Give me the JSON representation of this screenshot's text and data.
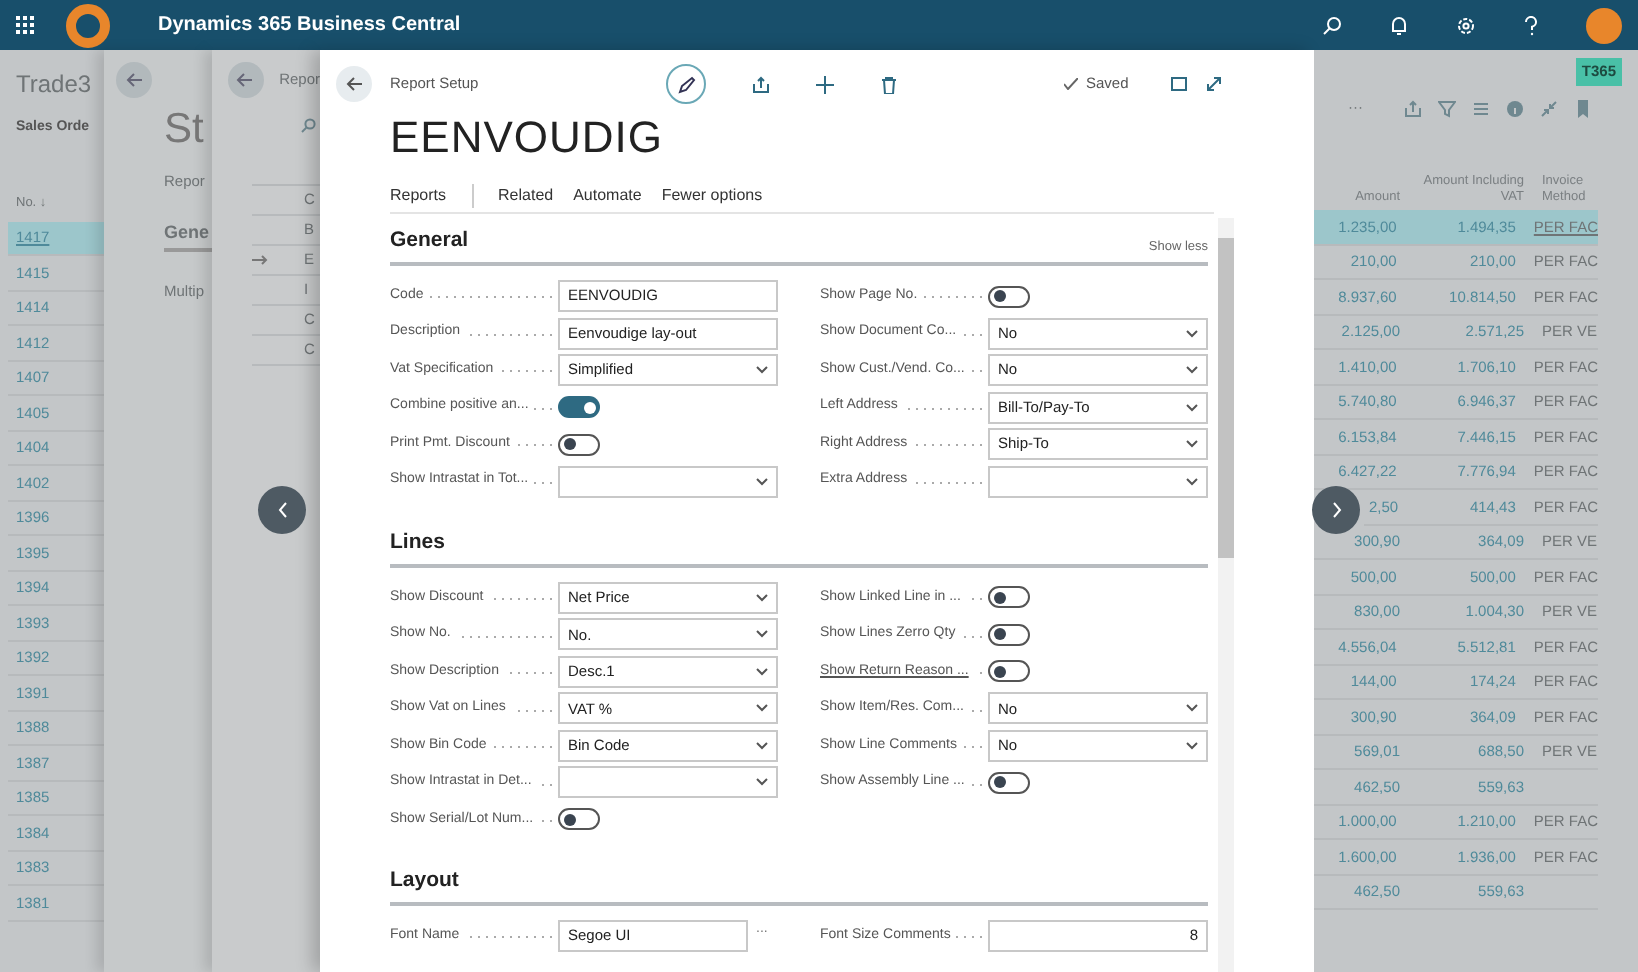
{
  "app_bar": {
    "title": "Dynamics 365 Business Central"
  },
  "list_page": {
    "title": "Trade3",
    "subtitle": "Sales Orde",
    "badge": "T365",
    "more": "···",
    "columns": [
      "No. ↓",
      "Amount",
      "Amount Including VAT",
      "Invoice Method"
    ],
    "rows": [
      {
        "no": "1417",
        "amount": "1.235,00",
        "amount_incl_vat": "1.494,35",
        "invoice_method": "PER FAC",
        "selected": true
      },
      {
        "no": "1415",
        "amount": "210,00",
        "amount_incl_vat": "210,00",
        "invoice_method": "PER FAC",
        "selected": false
      },
      {
        "no": "1414",
        "amount": "8.937,60",
        "amount_incl_vat": "10.814,50",
        "invoice_method": "PER FAC",
        "selected": false
      },
      {
        "no": "1412",
        "amount": "2.125,00",
        "amount_incl_vat": "2.571,25",
        "invoice_method": "PER VE",
        "selected": false
      },
      {
        "no": "1407",
        "amount": "1.410,00",
        "amount_incl_vat": "1.706,10",
        "invoice_method": "PER FAC",
        "selected": false
      },
      {
        "no": "1405",
        "amount": "5.740,80",
        "amount_incl_vat": "6.946,37",
        "invoice_method": "PER FAC",
        "selected": false
      },
      {
        "no": "1404",
        "amount": "6.153,84",
        "amount_incl_vat": "7.446,15",
        "invoice_method": "PER FAC",
        "selected": false
      },
      {
        "no": "1402",
        "amount": "6.427,22",
        "amount_incl_vat": "7.776,94",
        "invoice_method": "PER FAC",
        "selected": false
      },
      {
        "no": "1396",
        "amount": "2,50",
        "amount_incl_vat": "414,43",
        "invoice_method": "PER FAC",
        "selected": false
      },
      {
        "no": "1395",
        "amount": "300,90",
        "amount_incl_vat": "364,09",
        "invoice_method": "PER VE",
        "selected": false
      },
      {
        "no": "1394",
        "amount": "500,00",
        "amount_incl_vat": "500,00",
        "invoice_method": "PER FAC",
        "selected": false
      },
      {
        "no": "1393",
        "amount": "830,00",
        "amount_incl_vat": "1.004,30",
        "invoice_method": "PER VE",
        "selected": false
      },
      {
        "no": "1392",
        "amount": "4.556,04",
        "amount_incl_vat": "5.512,81",
        "invoice_method": "PER FAC",
        "selected": false
      },
      {
        "no": "1391",
        "amount": "144,00",
        "amount_incl_vat": "174,24",
        "invoice_method": "PER FAC",
        "selected": false
      },
      {
        "no": "1388",
        "amount": "300,90",
        "amount_incl_vat": "364,09",
        "invoice_method": "PER FAC",
        "selected": false
      },
      {
        "no": "1387",
        "amount": "569,01",
        "amount_incl_vat": "688,50",
        "invoice_method": "PER VE",
        "selected": false
      },
      {
        "no": "1385",
        "amount": "462,50",
        "amount_incl_vat": "559,63",
        "selected": false
      },
      {
        "no": "1384",
        "amount": "1.000,00",
        "amount_incl_vat": "1.210,00",
        "invoice_method": "PER FAC",
        "selected": false
      },
      {
        "no": "1383",
        "amount": "1.600,00",
        "amount_incl_vat": "1.936,00",
        "invoice_method": "PER FAC",
        "selected": false
      },
      {
        "no": "1381",
        "amount": "462,50",
        "amount_incl_vat": "559,63",
        "selected": false
      }
    ]
  },
  "card_page": {
    "title": "St",
    "tab": "Repor",
    "section": "Gene",
    "field": "Multip"
  },
  "setup_list": {
    "title": "Repor",
    "column": "C",
    "rows": [
      {
        "text": "B",
        "current": false
      },
      {
        "text": "E",
        "current": true
      },
      {
        "text": "I",
        "current": false
      },
      {
        "text": "C",
        "current": false
      },
      {
        "text": "C",
        "current": false
      }
    ]
  },
  "dialog": {
    "caption": "Report Setup",
    "status": "Saved",
    "title": "EENVOUDIG",
    "actions": [
      {
        "label": "Reports",
        "separated": true
      },
      {
        "label": "Related",
        "separated": false
      },
      {
        "label": "Automate",
        "separated": false
      },
      {
        "label": "Fewer options",
        "separated": false
      }
    ],
    "sections": [
      {
        "title": "General",
        "toggle_label": "Show less",
        "columns": [
          [
            {
              "label": "Code",
              "kind": "text",
              "value": "EENVOUDIG"
            },
            {
              "label": "Description",
              "kind": "text",
              "value": "Eenvoudige lay-out"
            },
            {
              "label": "Vat Specification",
              "kind": "select",
              "value": "Simplified"
            },
            {
              "label": "Combine positive an...",
              "kind": "toggle",
              "on": true
            },
            {
              "label": "Print Pmt. Discount",
              "kind": "toggle",
              "on": false
            },
            {
              "label": "Show Intrastat in Tot...",
              "kind": "select"
            }
          ],
          [
            {
              "label": "Show Page No.",
              "kind": "toggle",
              "on": false
            },
            {
              "label": "Show Document Co...",
              "kind": "select",
              "value": "No"
            },
            {
              "label": "Show Cust./Vend. Co...",
              "kind": "select",
              "value": "No"
            },
            {
              "label": "Left Address",
              "kind": "select",
              "value": "Bill-To/Pay-To"
            },
            {
              "label": "Right Address",
              "kind": "select",
              "value": "Ship-To"
            },
            {
              "label": "Extra Address",
              "kind": "select"
            }
          ]
        ]
      },
      {
        "title": "Lines",
        "columns": [
          [
            {
              "label": "Show Discount",
              "kind": "select",
              "value": "Net Price"
            },
            {
              "label": "Show No.",
              "kind": "select",
              "value": "No."
            },
            {
              "label": "Show Description",
              "kind": "select",
              "value": "Desc.1"
            },
            {
              "label": "Show Vat on Lines",
              "kind": "select",
              "value": "VAT %"
            },
            {
              "label": "Show Bin Code",
              "kind": "select",
              "value": "Bin Code"
            },
            {
              "label": "Show Intrastat in Det...",
              "kind": "select"
            },
            {
              "label": "Show Serial/Lot Num...",
              "kind": "toggle",
              "on": false
            }
          ],
          [
            {
              "label": "Show Linked Line in ...",
              "kind": "toggle",
              "on": false,
              "underlined": false
            },
            {
              "label": "Show Lines Zerro Qty",
              "kind": "toggle",
              "on": false,
              "underlined": false
            },
            {
              "label": "Show Return Reason ...",
              "kind": "toggle",
              "on": false,
              "underlined": true
            },
            {
              "label": "Show Item/Res. Com...",
              "kind": "select",
              "value": "No",
              "underlined": false
            },
            {
              "label": "Show Line Comments",
              "kind": "select",
              "value": "No",
              "underlined": false
            },
            {
              "label": "Show Assembly Line ...",
              "kind": "toggle",
              "on": false,
              "underlined": false
            }
          ]
        ]
      },
      {
        "title": "Layout",
        "columns": [
          [
            {
              "label": "Font Name",
              "kind": "lookup",
              "value": "Segoe UI",
              "button": "..."
            }
          ],
          [
            {
              "label": "Font Size Comments",
              "kind": "number",
              "value": "8"
            }
          ]
        ]
      }
    ]
  }
}
